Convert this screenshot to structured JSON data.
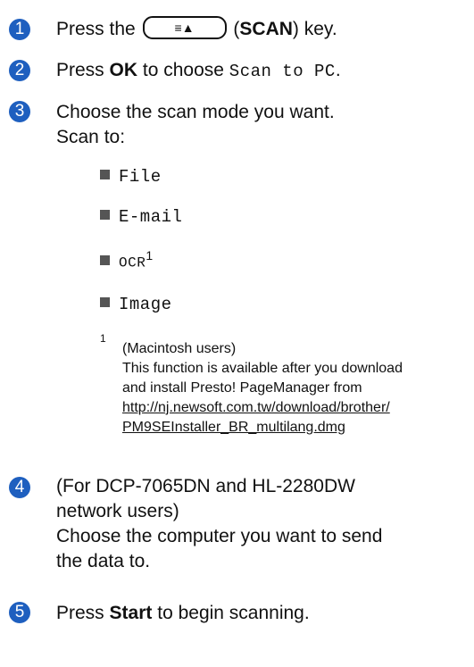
{
  "steps": [
    {
      "num": "1",
      "pre": "Press the",
      "key_symbol": "≡▲",
      "key_name": "SCAN",
      "post": "key."
    },
    {
      "num": "2",
      "pre": "Press",
      "bold": "OK",
      "mid": "to choose",
      "mono": "Scan to PC",
      "post": "."
    },
    {
      "num": "3",
      "line1": "Choose the scan mode you want.",
      "line2": "Scan to:"
    },
    {
      "num": "4",
      "line1": "(For DCP-7065DN and HL-2280DW",
      "line2": "network users)",
      "line3": "Choose the computer you want to send",
      "line4": "the data to."
    },
    {
      "num": "5",
      "pre": "Press",
      "bold": "Start",
      "post": "to begin scanning."
    }
  ],
  "scan_options": [
    "File",
    "E-mail",
    "OCR",
    "Image"
  ],
  "ocr_footnote_mark": "1",
  "footnote": {
    "mark": "1",
    "line1": "(Macintosh users)",
    "line2": "This function is available after you download",
    "line3": "and install Presto! PageManager from",
    "link1": "http://nj.newsoft.com.tw/download/brother/",
    "link2": "PM9SEInstaller_BR_multilang.dmg"
  }
}
